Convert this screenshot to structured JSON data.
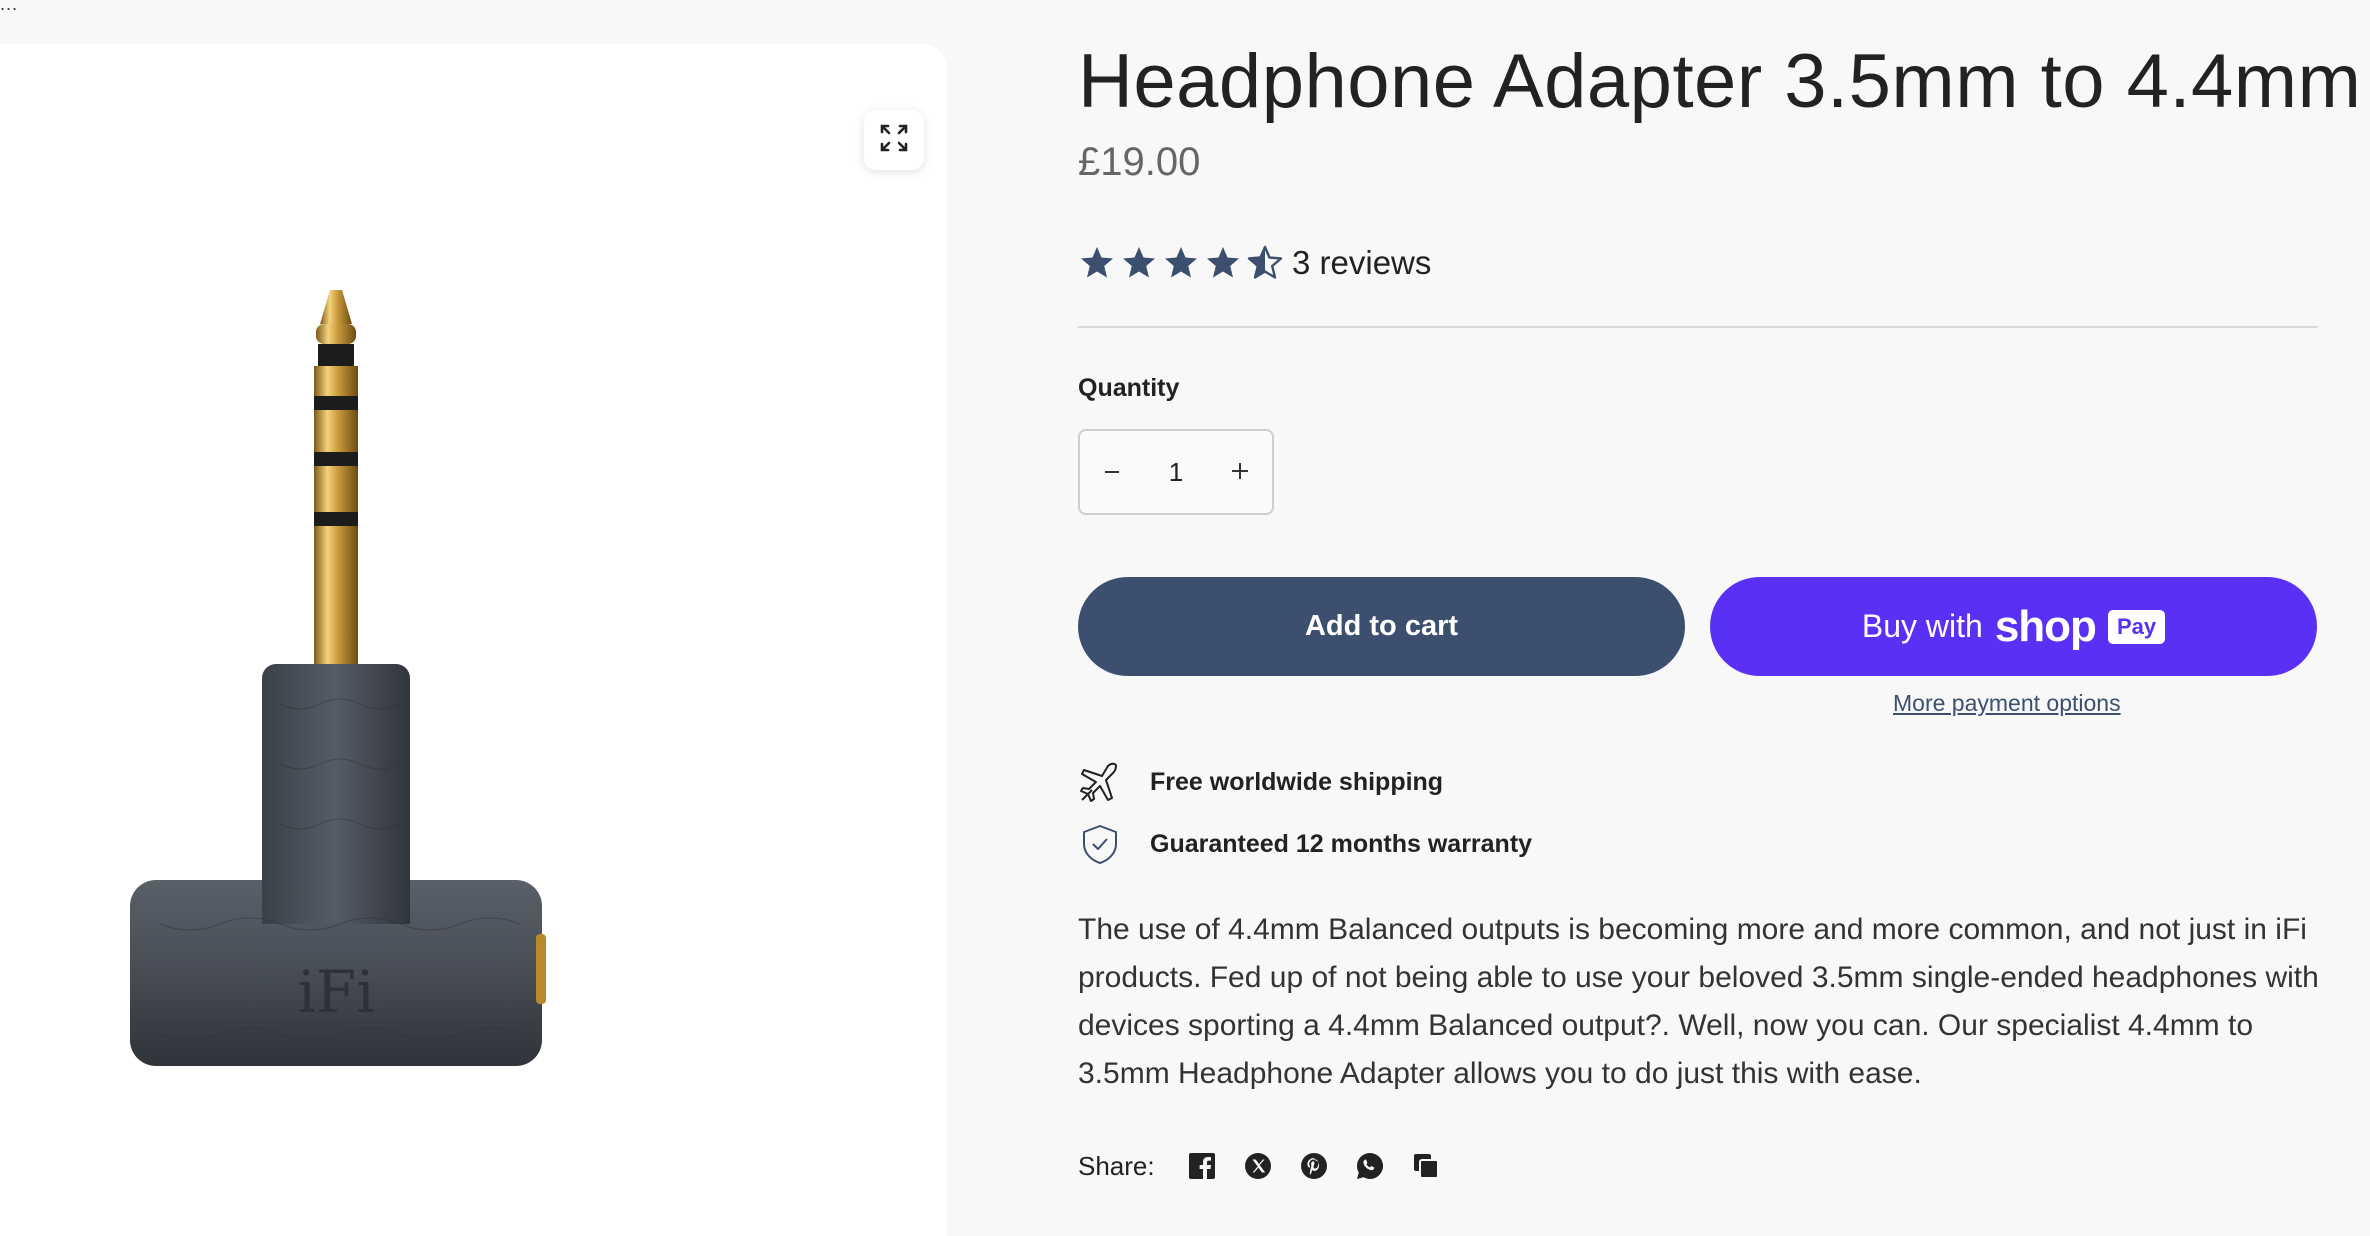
{
  "corner_mark": "...",
  "media": {
    "zoom_icon": "expand-icon",
    "image_alt": "iFi 3.5mm to 4.4mm headphone adapter",
    "brand_logo": "iFi"
  },
  "product": {
    "title": "Headphone Adapter 3.5mm to 4.4mm",
    "price": "£19.00",
    "rating": 4.5,
    "rating_max": 5,
    "reviews_text": "3 reviews"
  },
  "quantity": {
    "label": "Quantity",
    "value": "1",
    "minus_icon": "minus-icon",
    "plus_icon": "plus-icon"
  },
  "buttons": {
    "add_to_cart": "Add to cart",
    "buy_with": "Buy with",
    "shop_word": "shop",
    "pay_badge": "Pay",
    "more_payment": "More payment options"
  },
  "features": [
    {
      "icon": "plane-icon",
      "text": "Free worldwide shipping"
    },
    {
      "icon": "shield-check-icon",
      "text": "Guaranteed 12 months warranty"
    }
  ],
  "description": "The use of 4.4mm Balanced outputs is becoming more and more common, and not just in iFi products. Fed up of not being able to use your beloved 3.5mm single-ended headphones with devices sporting a 4.4mm Balanced output?. Well, now you can.  Our specialist 4.4mm to 3.5mm Headphone Adapter allows you to do just this with ease.",
  "share": {
    "label": "Share:",
    "icons": [
      "facebook-icon",
      "x-icon",
      "pinterest-icon",
      "whatsapp-icon",
      "copy-link-icon"
    ]
  },
  "colors": {
    "accent": "#3c4f6e",
    "shop_pay": "#5a31f4",
    "star": "#3c4f6e",
    "background": "#f8f8f8"
  }
}
